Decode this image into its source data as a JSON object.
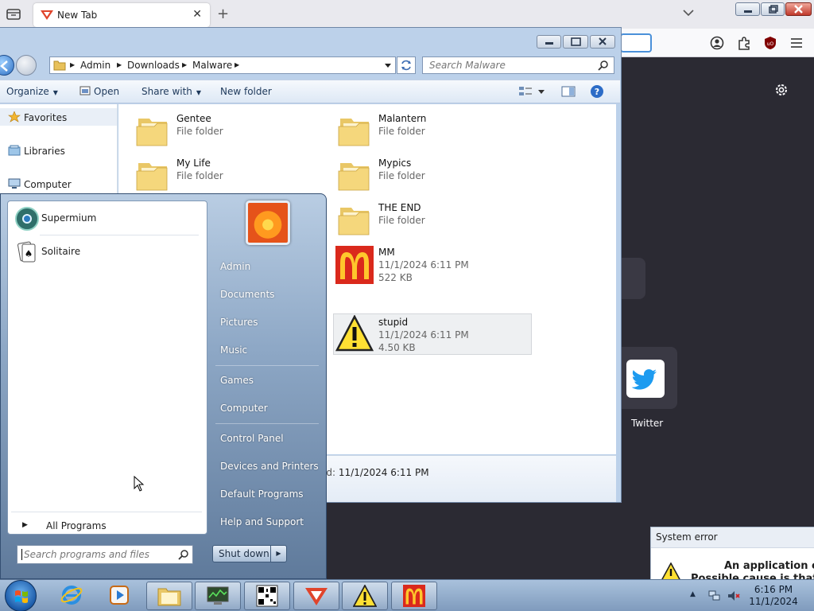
{
  "browser": {
    "tab_title": "New Tab",
    "shortcut_label": "Twitter"
  },
  "explorer": {
    "breadcrumb": [
      "Admin",
      "Downloads",
      "Malware"
    ],
    "search_placeholder": "Search Malware",
    "commands": {
      "organize": "Organize",
      "open": "Open",
      "share_with": "Share with",
      "new_folder": "New folder"
    },
    "nav": [
      "Favorites",
      "Libraries",
      "Computer"
    ],
    "items": [
      {
        "name": "Gentee",
        "line1": "File folder",
        "line2": ""
      },
      {
        "name": "Malantern",
        "line1": "File folder",
        "line2": ""
      },
      {
        "name": "My Life",
        "line1": "File folder",
        "line2": ""
      },
      {
        "name": "Mypics",
        "line1": "File folder",
        "line2": ""
      },
      {
        "name": "THE END",
        "line1": "File folder",
        "line2": ""
      },
      {
        "name": "MM",
        "line1": "11/1/2024 6:11 PM",
        "line2": "522 KB"
      },
      {
        "name": "stupid",
        "line1": "11/1/2024 6:11 PM",
        "line2": "4.50 KB"
      }
    ],
    "details_label": "ed:",
    "details_value": "11/1/2024 6:11 PM"
  },
  "start_menu": {
    "programs": [
      "Supermium",
      "Solitaire"
    ],
    "all_programs": "All Programs",
    "search_placeholder": "Search programs and files",
    "links": [
      "Admin",
      "Documents",
      "Pictures",
      "Music",
      "Games",
      "Computer",
      "Control Panel",
      "Devices and Printers",
      "Default Programs",
      "Help and Support"
    ],
    "shutdown": "Shut down"
  },
  "system_error": {
    "title": "System error",
    "line1": "An application err",
    "line2": "Possible cause is that y"
  },
  "taskbar": {
    "time": "6:16 PM",
    "date": "11/1/2024"
  },
  "colors": {
    "browser_dark": "#2b2a33",
    "explorer_frame": "#bcd1ea",
    "start_menu_base": "#8ea8c6",
    "mcdonalds_red": "#da291c",
    "mcdonalds_yellow": "#ffc72c",
    "warning_yellow": "#ffe033",
    "twitter_blue": "#1d9bf0"
  }
}
